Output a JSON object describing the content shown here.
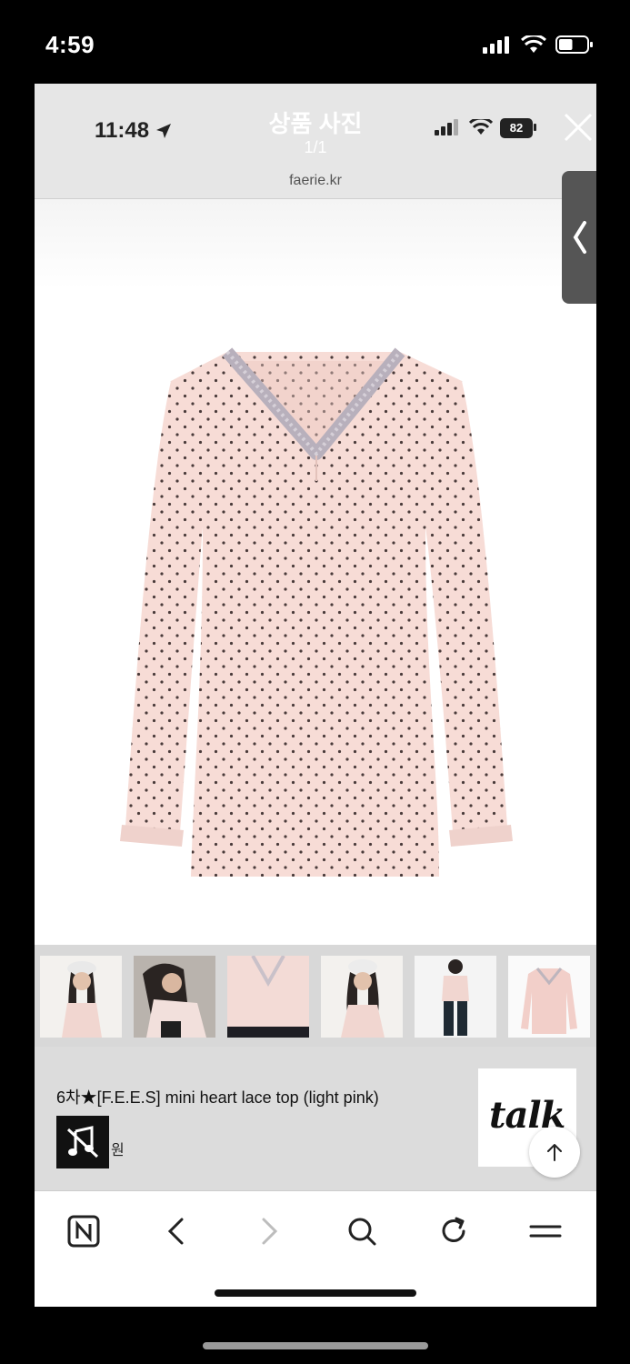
{
  "outer_status": {
    "time": "4:59",
    "battery_level": 0.5
  },
  "viewer": {
    "time": "11:48",
    "title": "상품 사진",
    "counter": "1/1",
    "url": "faerie.kr",
    "battery": "82"
  },
  "thumbnails": [
    {
      "name": "thumb-1"
    },
    {
      "name": "thumb-2"
    },
    {
      "name": "thumb-3"
    },
    {
      "name": "thumb-4"
    },
    {
      "name": "thumb-5"
    },
    {
      "name": "thumb-6"
    }
  ],
  "product": {
    "title": "6차★[F.E.E.S] mini heart lace top (light pink)",
    "price_suffix": "원",
    "talk_label": "talk"
  },
  "icons": {
    "location": "location-arrow-icon",
    "close": "close-icon",
    "music": "music-off-icon",
    "scroll_top": "arrow-up-icon",
    "home": "naver-home-icon",
    "back": "chevron-left-icon",
    "forward": "chevron-right-icon",
    "search": "search-icon",
    "refresh": "refresh-icon",
    "menu": "menu-icon"
  },
  "colors": {
    "shirt": "#f7dcd6",
    "lace": "#b8b0bc",
    "dots": "#2b1f1f",
    "forward_disabled": "#bdbdbd"
  }
}
